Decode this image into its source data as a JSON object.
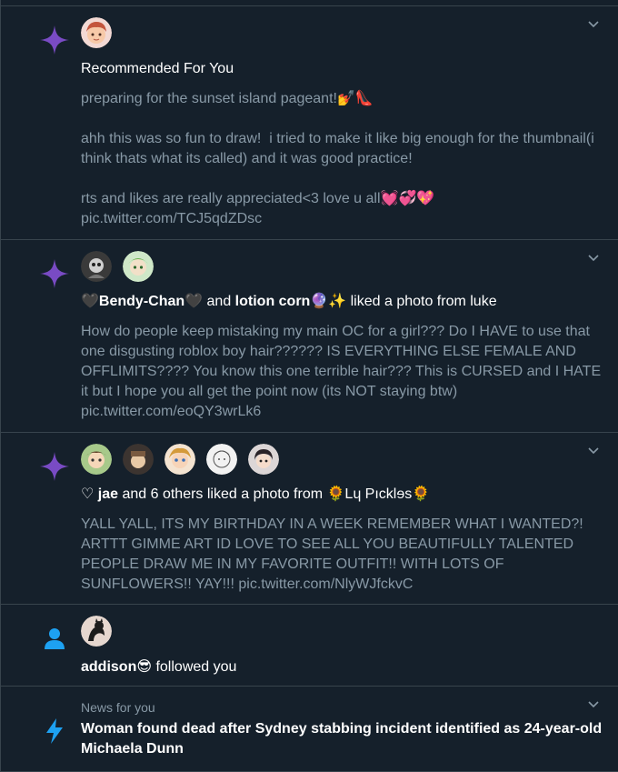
{
  "items": [
    {
      "title": "Recommended For You",
      "body": "preparing for the sunset island pageant!💅👠\n\nahh this was so fun to draw!  i tried to make it like big enough for the thumbnail(i think thats what its called) and it was good practice!\n\nrts and likes are really appreciated<3 love u all💓💞💖\npic.twitter.com/TCJ5qdZDsc"
    },
    {
      "title_user1": "🖤Bendy-Chan🖤",
      "title_and": " and ",
      "title_user2": "lotion corn🔮✨",
      "title_rest": " liked a photo from luke",
      "body": "How do people keep mistaking my main OC for a girl??? Do I HAVE to use that one disgusting roblox boy hair?????? IS EVERYTHING ELSE FEMALE AND OFFLIMITS???? You know this one terrible hair??? This is CURSED and I HATE it but I hope you all get the point now (its NOT staying btw)\npic.twitter.com/eoQY3wrLk6"
    },
    {
      "title_user1": "♡ jae",
      "title_rest": " and 6 others liked a photo from 🌻Lɥ Pıcklɘs🌻",
      "body": "YALL YALL, ITS MY BIRTHDAY IN A WEEK REMEMBER WHAT I WANTED?! ARTTT GIMME ART ID LOVE TO SEE ALL YOU BEAUTIFULLY TALENTED PEOPLE DRAW ME IN MY FAVORITE OUTFIT!! WITH LOTS OF SUNFLOWERS!! YAY!!! pic.twitter.com/NlyWJfckvC"
    },
    {
      "title_user1": "addison😎",
      "title_rest": " followed you"
    },
    {
      "context": "News for you",
      "title": "Woman found dead after Sydney stabbing incident identified as 24-year-old Michaela Dunn"
    }
  ],
  "colors": {
    "background": "#15202b",
    "border": "#38444d",
    "muted_text": "#8899a6",
    "sparkle_purple": "#794bc4",
    "follow_blue": "#1da1f2"
  }
}
